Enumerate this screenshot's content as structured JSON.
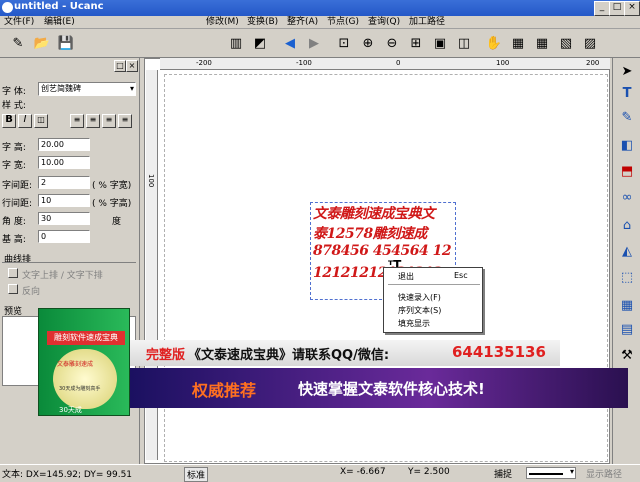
{
  "window": {
    "title": "untitled - Ucanc"
  },
  "menu": {
    "file": "文件(F)",
    "edit": "编辑(E)",
    "modify": "修改(M)",
    "transform": "变换(B)",
    "arrange": "整齐(A)",
    "node": "节点(G)",
    "query": "查询(Q)",
    "process": "加工路径"
  },
  "panel": {
    "font_label": "字 体:",
    "font_value": "创艺简魏碑",
    "style_label": "样 式:",
    "bold": "B",
    "italic": "I",
    "height_label": "字 高:",
    "height_value": "20.00",
    "width_label": "字 宽:",
    "width_value": "10.00",
    "char_space_label": "字间距:",
    "char_space_value": "2",
    "char_space_unit": "( % 字宽)",
    "line_space_label": "行间距:",
    "line_space_value": "10",
    "line_space_unit": "( % 字高)",
    "angle_label": "角 度:",
    "angle_value": "30",
    "angle_unit": "度",
    "base_label": "基 高:",
    "base_value": "0",
    "curve_section": "曲线排",
    "curve_up": "文字上排 / 文字下排",
    "reverse": "反向",
    "preview": "预览"
  },
  "ruler": {
    "h1": "-200",
    "h2": "-100",
    "h3": "0",
    "h4": "100",
    "h5": "200",
    "v1": "100"
  },
  "canvas_text": {
    "line1": "文泰雕刻速成宝典文",
    "line2": "泰12578雕刻速成",
    "line3": "878456 454564 12",
    "line4": "12121212121212"
  },
  "context_menu": {
    "exit": "退出",
    "exit_key": "Esc",
    "quick_input": "快速录入(F)",
    "seq_text": "序列文本(S)",
    "fill_display": "填充显示"
  },
  "ad": {
    "line1_prefix": "完整版",
    "line1_text": "《文泰速成宝典》请联系QQ/微信:",
    "line1_number": "644135136",
    "line2_prefix": "权威推荐",
    "line2_text": "快速掌握文泰软件核心技术!",
    "box_title": "雕刻软件速成宝典",
    "box_sub": "文泰雕刻速成",
    "box_cd": "30天成为雕刻高手",
    "box_bottom": "30天成"
  },
  "status": {
    "text": "文本: DX=145.92; DY= 99.51",
    "mode": "标准",
    "x": "X= -6.667",
    "y": "Y= 2.500",
    "snap": "捕捉",
    "show_path": "显示路径"
  },
  "colors": {
    "title_bg": "#2458c8",
    "canvas_text": "#d01818",
    "ad_red": "#e02020",
    "ad_purple": "#4a1a7a"
  }
}
